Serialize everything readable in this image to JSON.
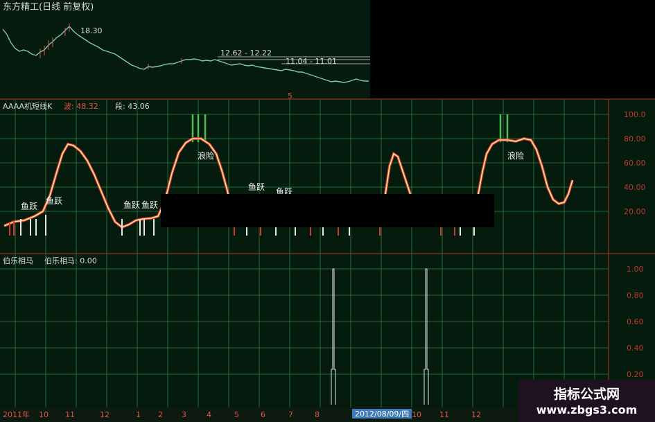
{
  "price_panel": {
    "title": "东方精工(日线 前复权)",
    "high_label": "18.30",
    "range1": "12.62 - 12.22",
    "range2": "11.04 - 11.01",
    "marker": "5"
  },
  "indicator_panel": {
    "name": "AAAA机短线K",
    "wave_label": "波: 48.32",
    "segment_label": "段: 43.06",
    "y_ticks": [
      "100.0",
      "80.00",
      "60.00",
      "40.00",
      "20.00"
    ],
    "annotations": {
      "fish_jump": "鱼跃",
      "danger": "浪险",
      "fish_jump_partial": "鱼跃"
    }
  },
  "bole_panel": {
    "name": "伯乐相马",
    "value_label": "伯乐相马: 0.00",
    "y_ticks": [
      "1.00",
      "0.80",
      "0.60",
      "0.40",
      "0.20"
    ]
  },
  "timeline": {
    "labels": [
      "2011年",
      "10",
      "11",
      "12",
      "1",
      "2",
      "3",
      "4",
      "5",
      "6",
      "7",
      "8",
      "9",
      "10",
      "11",
      "12"
    ],
    "cursor_date": "2012/08/09/四"
  },
  "watermark": {
    "name": "指标公式网",
    "url": "www.zbgs3.com"
  },
  "colors": {
    "grid": "#1e6e3a",
    "axis_red": "#c0392b",
    "line_yellow": "#f3e9a2",
    "line_red": "#d83a2a",
    "cyan_price": "#7fc8c0"
  }
}
